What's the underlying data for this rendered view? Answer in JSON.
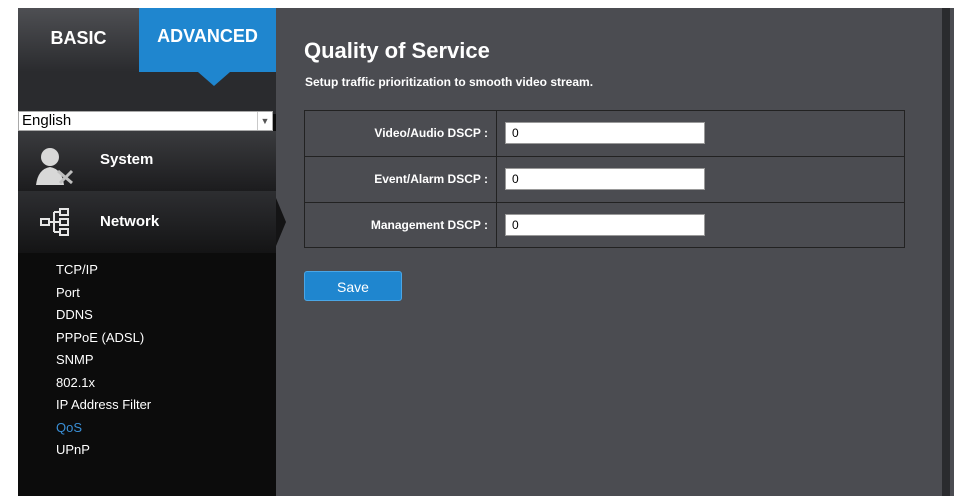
{
  "tabs": {
    "basic": "BASIC",
    "advanced": "ADVANCED"
  },
  "language": {
    "selected": "English"
  },
  "nav": {
    "system": "System",
    "network": "Network",
    "network_items": [
      {
        "label": "TCP/IP"
      },
      {
        "label": "Port"
      },
      {
        "label": "DDNS"
      },
      {
        "label": "PPPoE (ADSL)"
      },
      {
        "label": "SNMP"
      },
      {
        "label": "802.1x"
      },
      {
        "label": "IP Address Filter"
      },
      {
        "label": "QoS"
      },
      {
        "label": "UPnP"
      }
    ],
    "active_item": "QoS"
  },
  "page": {
    "title": "Quality of Service",
    "subtitle": "Setup traffic prioritization to smooth video stream."
  },
  "form": {
    "rows": [
      {
        "label": "Video/Audio DSCP :",
        "value": "0"
      },
      {
        "label": "Event/Alarm DSCP :",
        "value": "0"
      },
      {
        "label": "Management DSCP :",
        "value": "0"
      }
    ]
  },
  "actions": {
    "save": "Save"
  },
  "colors": {
    "accent": "#1f86cf",
    "panel_bg": "#4b4c51",
    "sidebar_bg": "#0c0c0c",
    "active_link": "#3a8fd6"
  }
}
